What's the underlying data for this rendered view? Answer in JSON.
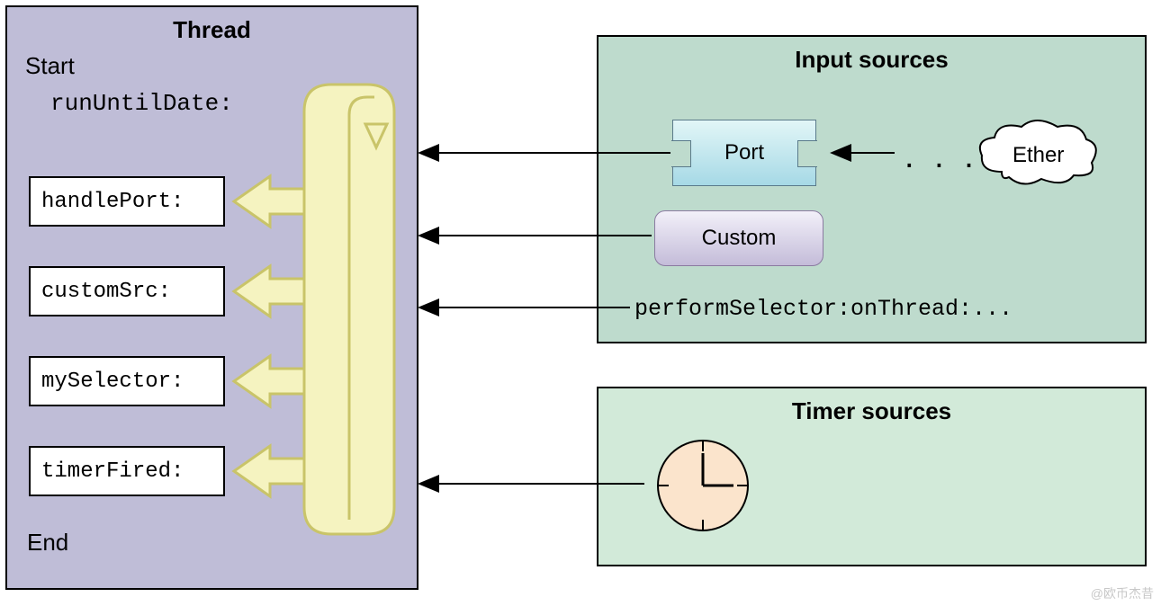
{
  "thread": {
    "title": "Thread",
    "start_label": "Start",
    "method": "runUntilDate:",
    "end_label": "End",
    "handlers": [
      "handlePort:",
      "customSrc:",
      "mySelector:",
      "timerFired:"
    ]
  },
  "input_sources": {
    "title": "Input sources",
    "port_label": "Port",
    "custom_label": "Custom",
    "perform_selector": "performSelector:onThread:...",
    "ether_label": "Ether",
    "dots": ". . ."
  },
  "timer_sources": {
    "title": "Timer sources"
  },
  "watermark": "@欧币杰昔"
}
